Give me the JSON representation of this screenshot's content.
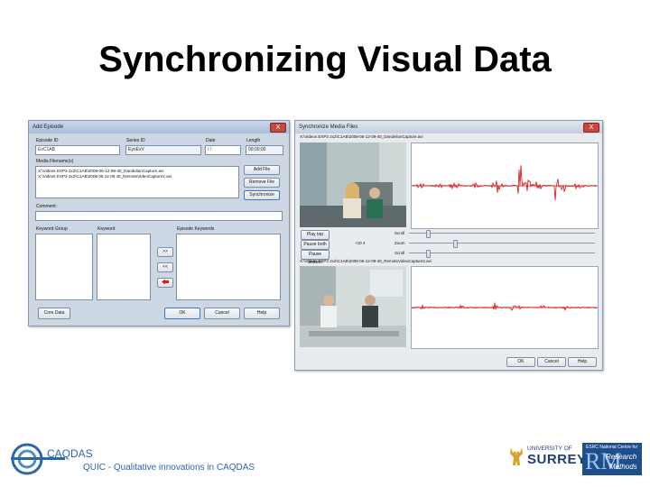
{
  "slide": {
    "title": "Synchronizing Visual Data"
  },
  "add_episode": {
    "title": "Add Episode",
    "close": "X",
    "episode_id_label": "Episode ID",
    "episode_id_value": "ExC1AB",
    "series_id_label": "Series ID",
    "series_id_value": "EynExV",
    "date_label": "Date",
    "date_value": "/ /",
    "length_label": "Length",
    "length_value": "00:00:00",
    "media_label": "Media Filename(s)",
    "media_files": [
      "X:\\Videos EXP3 2x2\\C1AB\\2008-06-12-09-40_DandelionCapture.avi",
      "X:\\Videos EXP3 2x2\\C1AB\\2008 06 12 09 40_RemoteVideoCapture2.avi"
    ],
    "add_file": "Add File",
    "remove_file": "Remove File",
    "synchronize": "Synchronize",
    "comment_label": "Comment:",
    "keyword_group_label": "Keyword Group",
    "keyword_label": "Keyword",
    "episode_keywords_label": "Episode Keywords",
    "add_arrow": ">>",
    "remove_arrow": "<<",
    "core_data": "Core Data",
    "ok": "OK",
    "cancel": "Cancel",
    "help": "Help"
  },
  "sync_dialog": {
    "title": "Synchronize Media Files",
    "close": "X",
    "file1_path": "X:\\Videos EXP3 2x2\\C1AB\\2008-06-12-09-40_DandelionCapture.avi",
    "file2_path": "X:\\Videos EXP3 2x2\\C1AB\\2008-06-12-09-40_RemoteVideoCapture2.avi",
    "play_top": "Play top",
    "pause_both": "Pause both",
    "pause_bottom": "Pause bottom",
    "offset_value": "+10 4",
    "scroll_label": "Scroll",
    "zoom_label": "Zoom",
    "scroll2_label": "Scroll",
    "ok": "OK",
    "cancel": "Cancel",
    "help": "Help",
    "wave_color": "#d21414"
  },
  "footer": {
    "caqdas_name": "CAQDAS",
    "caqdas_tagline": "QUIC - Qualitative innovations in CAQDAS",
    "surrey_line1": "UNIVERSITY OF",
    "surrey_line2": "SURREY",
    "ncrm_line1": "ESRC National Centre for",
    "ncrm_research": "Research",
    "ncrm_methods": "Methods"
  }
}
